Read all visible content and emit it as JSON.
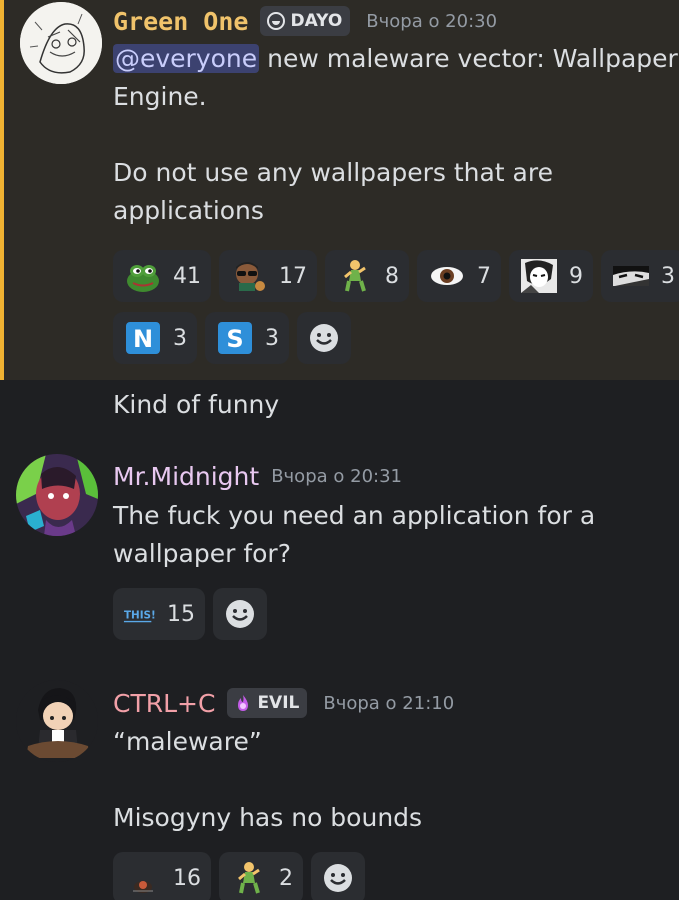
{
  "messages": [
    {
      "username": "Green One",
      "username_color": "#f0c36b",
      "tag": "DAYO",
      "time": "Вчора о 20:30",
      "mention": "@everyone",
      "line1_rest": " new maleware vector: Wallpaper",
      "line2": "Engine.",
      "line3": "Do not use any wallpapers that are",
      "line4": "applications",
      "reactions": [
        {
          "icon": "pepe-frog-emoji",
          "count": "41"
        },
        {
          "icon": "sunglasses-character-emoji",
          "count": "17"
        },
        {
          "icon": "dancing-figure-emoji",
          "count": "8"
        },
        {
          "icon": "eye-emoji",
          "count": "7"
        },
        {
          "icon": "manga-face-emoji",
          "count": "9"
        },
        {
          "icon": "manga-eyes-emoji",
          "count": "3"
        },
        {
          "icon": "letter-n-emoji",
          "letter": "N",
          "count": "3"
        },
        {
          "icon": "letter-s-emoji",
          "letter": "S",
          "count": "3"
        }
      ]
    },
    {
      "text": "Kind of funny"
    },
    {
      "username": "Mr.Midnight",
      "username_color": "#e8c8f0",
      "time": "Вчора о 20:31",
      "line1": "The fuck you need an application for a",
      "line2": "wallpaper for?",
      "reactions": [
        {
          "icon": "this-arrow-emoji",
          "label": "THIS!",
          "count": "15"
        }
      ]
    },
    {
      "username": "CTRL+C",
      "username_color": "#f2a0a8",
      "tag": "EVIL",
      "time": "Вчора о 21:10",
      "line1": "“maleware”",
      "line2": "Misogyny has no bounds",
      "reactions": [
        {
          "icon": "small-creature-emoji",
          "count": "16"
        },
        {
          "icon": "dancing-figure-emoji",
          "count": "2"
        }
      ]
    }
  ]
}
